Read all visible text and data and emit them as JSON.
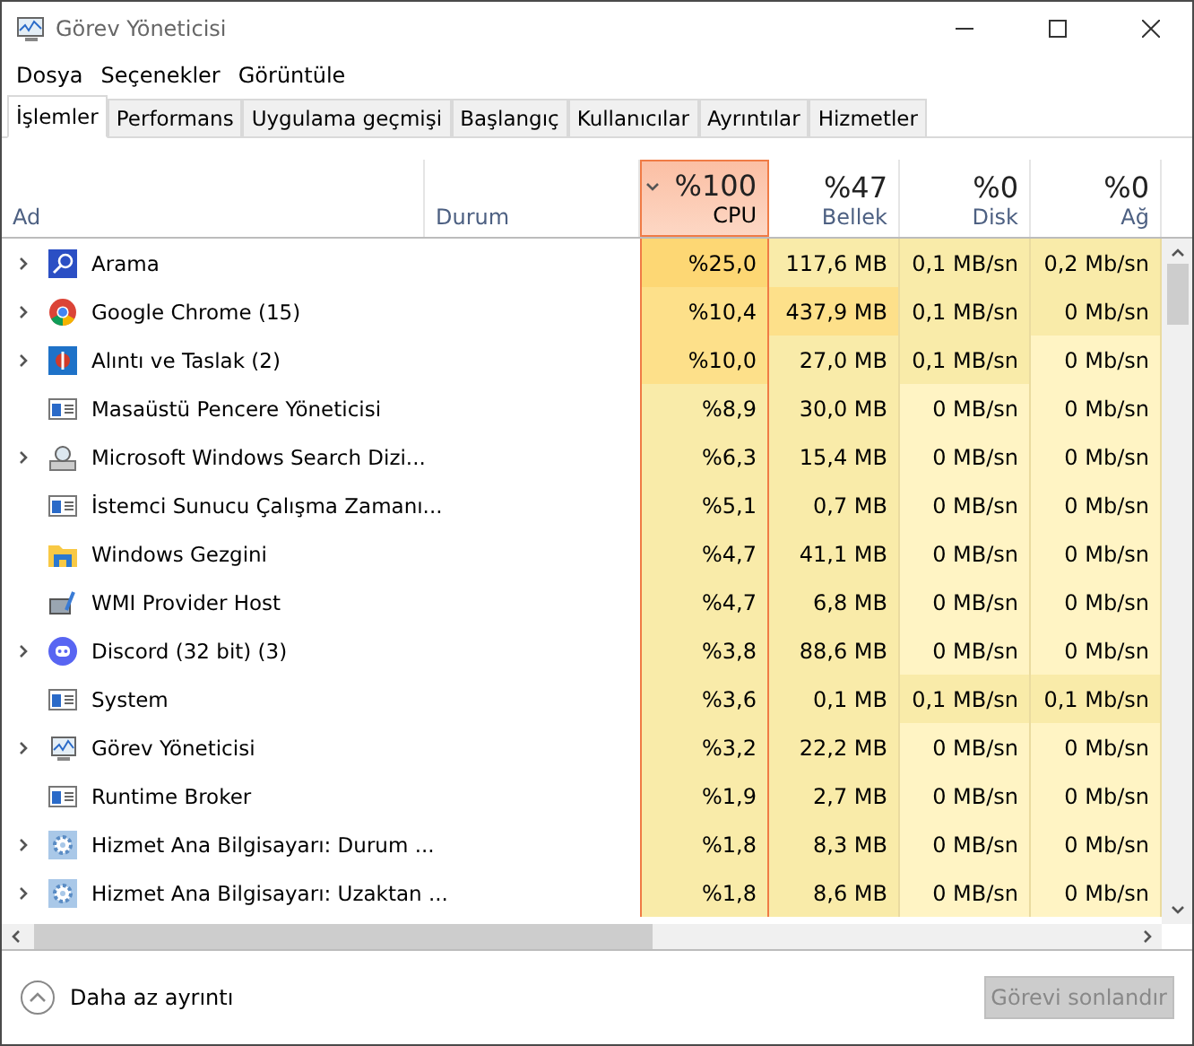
{
  "window": {
    "title": "Görev Yöneticisi"
  },
  "menu": [
    "Dosya",
    "Seçenekler",
    "Görüntüle"
  ],
  "tabs": [
    {
      "label": "İşlemler",
      "selected": true
    },
    {
      "label": "Performans",
      "selected": false
    },
    {
      "label": "Uygulama geçmişi",
      "selected": false
    },
    {
      "label": "Başlangıç",
      "selected": false
    },
    {
      "label": "Kullanıcılar",
      "selected": false
    },
    {
      "label": "Ayrıntılar",
      "selected": false
    },
    {
      "label": "Hizmetler",
      "selected": false
    }
  ],
  "columns": [
    {
      "label": "Ad",
      "selected": false
    },
    {
      "label": "Durum",
      "selected": false
    },
    {
      "percent": "%100",
      "label": "CPU",
      "selected": true
    },
    {
      "percent": "%47",
      "label": "Bellek",
      "selected": false
    },
    {
      "percent": "%0",
      "label": "Disk",
      "selected": false
    },
    {
      "percent": "%0",
      "label": "Ağ",
      "selected": false
    }
  ],
  "rows": [
    {
      "kind": "search",
      "expandable": true,
      "name": "Arama",
      "cells": [
        {
          "text": "%25,0",
          "color": "#fdd774"
        },
        {
          "text": "117,6 MB",
          "color": "#f9eba9"
        },
        {
          "text": "0,1 MB/sn",
          "color": "#f9eba9"
        },
        {
          "text": "0,2 Mb/sn",
          "color": "#f9eba9"
        }
      ]
    },
    {
      "kind": "chrome",
      "expandable": true,
      "name": "Google Chrome (15)",
      "cells": [
        {
          "text": "%10,4",
          "color": "#fde08a"
        },
        {
          "text": "437,9 MB",
          "color": "#fde08a"
        },
        {
          "text": "0,1 MB/sn",
          "color": "#f9eba9"
        },
        {
          "text": "0 Mb/sn",
          "color": "#f9eba9"
        }
      ]
    },
    {
      "kind": "snip",
      "expandable": true,
      "name": "Alıntı ve Taslak (2)",
      "cells": [
        {
          "text": "%10,0",
          "color": "#fde08a"
        },
        {
          "text": "27,0 MB",
          "color": "#f9eba9"
        },
        {
          "text": "0,1 MB/sn",
          "color": "#f9eba9"
        },
        {
          "text": "0 Mb/sn",
          "color": "#fff4c4"
        }
      ]
    },
    {
      "kind": "window",
      "expandable": false,
      "name": "Masaüstü Pencere Yöneticisi",
      "cells": [
        {
          "text": "%8,9",
          "color": "#f9eba9"
        },
        {
          "text": "30,0 MB",
          "color": "#f9eba9"
        },
        {
          "text": "0 MB/sn",
          "color": "#fff4c4"
        },
        {
          "text": "0 Mb/sn",
          "color": "#fff4c4"
        }
      ]
    },
    {
      "kind": "indexer",
      "expandable": true,
      "name": "Microsoft Windows Search Dizi...",
      "cells": [
        {
          "text": "%6,3",
          "color": "#f9eba9"
        },
        {
          "text": "15,4 MB",
          "color": "#f9eba9"
        },
        {
          "text": "0 MB/sn",
          "color": "#fff4c4"
        },
        {
          "text": "0 Mb/sn",
          "color": "#fff4c4"
        }
      ]
    },
    {
      "kind": "window",
      "expandable": false,
      "name": "İstemci Sunucu Çalışma Zamanı...",
      "cells": [
        {
          "text": "%5,1",
          "color": "#f9eba9"
        },
        {
          "text": "0,7 MB",
          "color": "#f9eba9"
        },
        {
          "text": "0 MB/sn",
          "color": "#fff4c4"
        },
        {
          "text": "0 Mb/sn",
          "color": "#fff4c4"
        }
      ]
    },
    {
      "kind": "folder",
      "expandable": false,
      "name": "Windows Gezgini",
      "cells": [
        {
          "text": "%4,7",
          "color": "#f9eba9"
        },
        {
          "text": "41,1 MB",
          "color": "#f9eba9"
        },
        {
          "text": "0 MB/sn",
          "color": "#fff4c4"
        },
        {
          "text": "0 Mb/sn",
          "color": "#fff4c4"
        }
      ]
    },
    {
      "kind": "wmi",
      "expandable": false,
      "name": "WMI Provider Host",
      "cells": [
        {
          "text": "%4,7",
          "color": "#f9eba9"
        },
        {
          "text": "6,8 MB",
          "color": "#f9eba9"
        },
        {
          "text": "0 MB/sn",
          "color": "#fff4c4"
        },
        {
          "text": "0 Mb/sn",
          "color": "#fff4c4"
        }
      ]
    },
    {
      "kind": "discord",
      "expandable": true,
      "name": "Discord (32 bit) (3)",
      "cells": [
        {
          "text": "%3,8",
          "color": "#f9eba9"
        },
        {
          "text": "88,6 MB",
          "color": "#f9eba9"
        },
        {
          "text": "0 MB/sn",
          "color": "#fff4c4"
        },
        {
          "text": "0 Mb/sn",
          "color": "#fff4c4"
        }
      ]
    },
    {
      "kind": "window",
      "expandable": false,
      "name": "System",
      "cells": [
        {
          "text": "%3,6",
          "color": "#f9eba9"
        },
        {
          "text": "0,1 MB",
          "color": "#f9eba9"
        },
        {
          "text": "0,1 MB/sn",
          "color": "#f9eba9"
        },
        {
          "text": "0,1 Mb/sn",
          "color": "#f9eba9"
        }
      ]
    },
    {
      "kind": "monitor",
      "expandable": true,
      "name": "Görev Yöneticisi",
      "cells": [
        {
          "text": "%3,2",
          "color": "#f9eba9"
        },
        {
          "text": "22,2 MB",
          "color": "#f9eba9"
        },
        {
          "text": "0 MB/sn",
          "color": "#fff4c4"
        },
        {
          "text": "0 Mb/sn",
          "color": "#fff4c4"
        }
      ]
    },
    {
      "kind": "window",
      "expandable": false,
      "name": "Runtime Broker",
      "cells": [
        {
          "text": "%1,9",
          "color": "#f9eba9"
        },
        {
          "text": "2,7 MB",
          "color": "#f9eba9"
        },
        {
          "text": "0 MB/sn",
          "color": "#fff4c4"
        },
        {
          "text": "0 Mb/sn",
          "color": "#fff4c4"
        }
      ]
    },
    {
      "kind": "gear",
      "expandable": true,
      "name": "Hizmet Ana Bilgisayarı: Durum ...",
      "cells": [
        {
          "text": "%1,8",
          "color": "#f9eba9"
        },
        {
          "text": "8,3 MB",
          "color": "#f9eba9"
        },
        {
          "text": "0 MB/sn",
          "color": "#fff4c4"
        },
        {
          "text": "0 Mb/sn",
          "color": "#fff4c4"
        }
      ]
    },
    {
      "kind": "gear",
      "expandable": true,
      "name": "Hizmet Ana Bilgisayarı: Uzaktan ...",
      "cells": [
        {
          "text": "%1,8",
          "color": "#f9eba9"
        },
        {
          "text": "8,6 MB",
          "color": "#f9eba9"
        },
        {
          "text": "0 MB/sn",
          "color": "#fff4c4"
        },
        {
          "text": "0 Mb/sn",
          "color": "#fff4c4"
        }
      ]
    }
  ],
  "footer": {
    "toggle": "Daha az ayrıntı",
    "end_task": {
      "label": "Görevi sonlandır",
      "disabled": true
    }
  }
}
